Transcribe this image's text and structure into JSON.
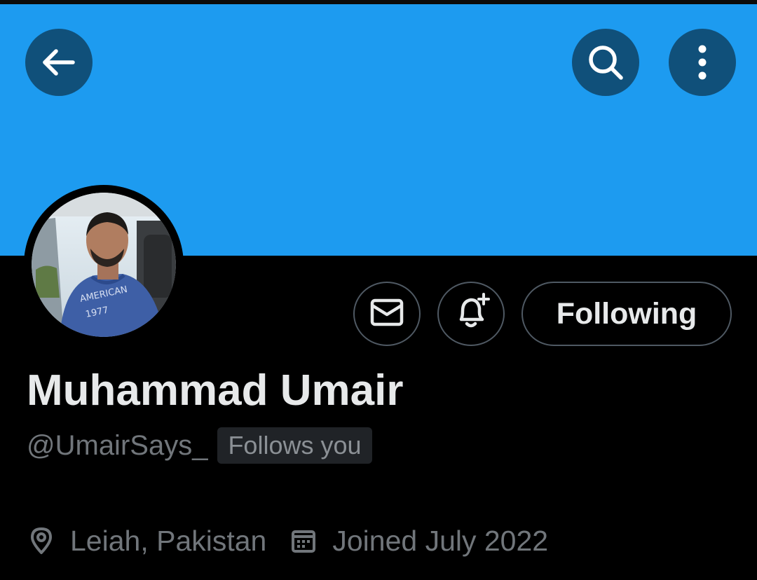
{
  "header": {
    "back_icon": "arrow-left-icon",
    "search_icon": "search-icon",
    "more_icon": "more-vertical-icon",
    "banner_color": "#1d9bf0",
    "button_color": "#10507a"
  },
  "profile": {
    "display_name": "Muhammad Umair",
    "handle": "@UmairSays_",
    "follows_you_badge": "Follows you",
    "location": "Leiah, Pakistan",
    "joined": "Joined July 2022",
    "avatar_alt": "profile photo"
  },
  "actions": {
    "message_icon": "envelope-icon",
    "notify_icon": "bell-plus-icon",
    "following_label": "Following"
  },
  "meta_icons": {
    "location_icon": "location-pin-icon",
    "calendar_icon": "calendar-icon"
  }
}
